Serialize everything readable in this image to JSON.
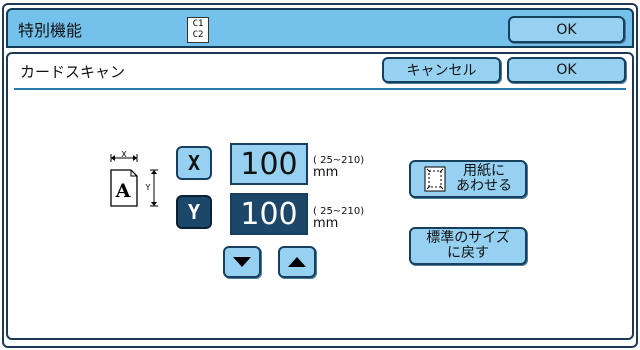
{
  "header": {
    "title": "特別機能",
    "badge_line1": "C1",
    "badge_line2": "C2",
    "ok_label": "OK"
  },
  "subheader": {
    "title": "カードスキャン",
    "cancel_label": "キャンセル",
    "ok_label": "OK"
  },
  "size": {
    "x": {
      "key": "X",
      "value": "100",
      "range": "( 25~210)",
      "unit": "mm"
    },
    "y": {
      "key": "Y",
      "value": "100",
      "range": "( 25~210)",
      "unit": "mm"
    }
  },
  "diagram": {
    "card_letter": "A",
    "x_axis": "X",
    "y_axis": "Y"
  },
  "buttons": {
    "fit_line1": "用紙に",
    "fit_line2": "あわせる",
    "standard_line1": "標準のサイズ",
    "standard_line2": "に戻す"
  },
  "icons": {
    "down": "triangle-down-icon",
    "up": "triangle-up-icon",
    "fit": "paper-fit-icon"
  },
  "colors": {
    "accent": "#74c1ec",
    "button": "#97d1f2",
    "selected": "#1c4769",
    "border": "#173f5e"
  }
}
